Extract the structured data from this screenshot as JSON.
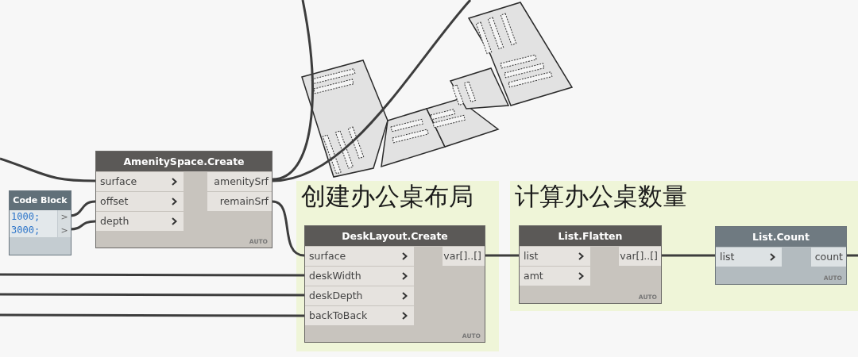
{
  "groups": [
    {
      "title": "创建办公桌布局"
    },
    {
      "title": "计算办公桌数量"
    }
  ],
  "code_block": {
    "title": "Code Block",
    "lines": [
      {
        "code": "1000;",
        "port": ">"
      },
      {
        "code": "3000;",
        "port": ">"
      }
    ]
  },
  "nodes": [
    {
      "title": "AmenitySpace.Create",
      "preview": true,
      "inputs": [
        "surface",
        "offset",
        "depth"
      ],
      "outputs": [
        "amenitySrf",
        "remainSrf"
      ],
      "lacing": "AUTO"
    },
    {
      "title": "DeskLayout.Create",
      "preview": true,
      "inputs": [
        "surface",
        "deskWidth",
        "deskDepth",
        "backToBack"
      ],
      "outputs": [
        "var[]..[]"
      ],
      "lacing": "AUTO"
    },
    {
      "title": "List.Flatten",
      "preview": true,
      "inputs": [
        "list",
        "amt"
      ],
      "outputs": [
        "var[]..[]"
      ],
      "lacing": "AUTO"
    },
    {
      "title": "List.Count",
      "preview": false,
      "inputs": [
        "list"
      ],
      "outputs": [
        "count"
      ],
      "lacing": "AUTO"
    }
  ]
}
